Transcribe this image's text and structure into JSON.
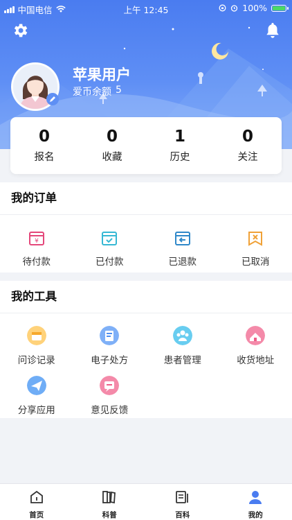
{
  "status_bar": {
    "carrier": "中国电信",
    "time": "上午 12:45",
    "battery": "100%"
  },
  "profile": {
    "username": "苹果用户",
    "balance_label": "爱币余额",
    "balance_value": "5"
  },
  "stats": [
    {
      "value": "0",
      "label": "报名"
    },
    {
      "value": "0",
      "label": "收藏"
    },
    {
      "value": "1",
      "label": "历史"
    },
    {
      "value": "0",
      "label": "关注"
    }
  ],
  "orders": {
    "title": "我的订单",
    "items": [
      {
        "label": "待付款",
        "icon": "pending-payment-icon",
        "color": "#e4477a"
      },
      {
        "label": "已付款",
        "icon": "paid-icon",
        "color": "#36b8d4"
      },
      {
        "label": "已退款",
        "icon": "refund-icon",
        "color": "#2f88c9"
      },
      {
        "label": "已取消",
        "icon": "cancelled-icon",
        "color": "#f0a137"
      }
    ]
  },
  "tools": {
    "title": "我的工具",
    "items": [
      {
        "label": "问诊记录",
        "icon": "consultation-record-icon",
        "color": "#f6b23f"
      },
      {
        "label": "电子处方",
        "icon": "e-prescription-icon",
        "color": "#4f8ef0"
      },
      {
        "label": "患者管理",
        "icon": "patient-management-icon",
        "color": "#3cb7e8"
      },
      {
        "label": "收货地址",
        "icon": "shipping-address-icon",
        "color": "#ee5e88"
      },
      {
        "label": "分享应用",
        "icon": "share-app-icon",
        "color": "#3b8ff0"
      },
      {
        "label": "意见反馈",
        "icon": "feedback-icon",
        "color": "#ef5d8a"
      }
    ]
  },
  "tabbar": [
    {
      "label": "首页",
      "icon": "home-icon",
      "active": false
    },
    {
      "label": "科普",
      "icon": "science-book-icon",
      "active": false
    },
    {
      "label": "百科",
      "icon": "encyclopedia-icon",
      "active": false
    },
    {
      "label": "我的",
      "icon": "profile-icon",
      "active": true
    }
  ],
  "colors": {
    "header": "#4a7cf0",
    "active_tab": "#4a7cf0"
  }
}
